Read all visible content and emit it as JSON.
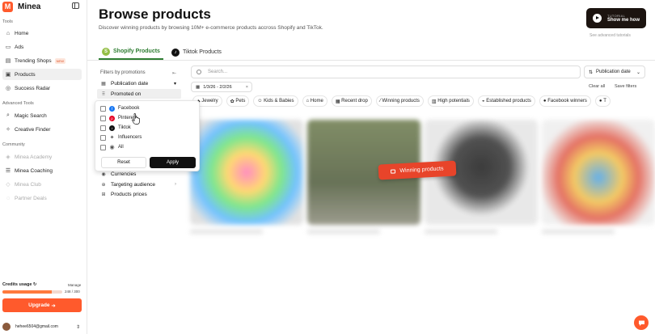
{
  "app": {
    "name": "Minea"
  },
  "sidebar": {
    "section_tools": "Tools",
    "tools": [
      {
        "label": "Home",
        "icon": "home-icon"
      },
      {
        "label": "Ads",
        "icon": "ads-icon"
      },
      {
        "label": "Trending Shops",
        "icon": "shop-icon",
        "badge": "NEW"
      },
      {
        "label": "Products",
        "icon": "products-icon",
        "active": true
      },
      {
        "label": "Success Radar",
        "icon": "radar-icon"
      }
    ],
    "section_advanced": "Advanced Tools",
    "advanced": [
      {
        "label": "Magic Search",
        "icon": "magic-search-icon"
      },
      {
        "label": "Creative Finder",
        "icon": "creative-icon"
      }
    ],
    "section_community": "Community",
    "community": [
      {
        "label": "Minea Academy",
        "icon": "academy-icon",
        "muted": true
      },
      {
        "label": "Minea Coaching",
        "icon": "coaching-icon",
        "muted": false
      },
      {
        "label": "Minea Club",
        "icon": "club-icon",
        "muted": true
      },
      {
        "label": "Partner Deals",
        "icon": "deals-icon",
        "muted": true
      }
    ],
    "credits": {
      "label": "Credits usage",
      "manage": "Manage",
      "count": "248 / 300",
      "fraction": 0.83
    },
    "upgrade_label": "Upgrade",
    "user_email": "hehee6504@gmail.com"
  },
  "header": {
    "title": "Browse products",
    "subtitle": "Discover winning products by browsing 10M+ e-commerce products accross Shopify and TikTok.",
    "tutorial_kicker": "TUTORIAL",
    "tutorial_label": "Show me how",
    "see_advanced": "See advanced tutorials"
  },
  "tabs": [
    {
      "label": "Shopify Products",
      "active": true
    },
    {
      "label": "Tiktok Products",
      "active": false
    }
  ],
  "search": {
    "placeholder": "Search..."
  },
  "sort": {
    "label": "Publication date"
  },
  "date_chip": "1/3/26 - 2/2/26",
  "actions": {
    "clear_all": "Clear all",
    "save_filters": "Save filters"
  },
  "categories": [
    "Jewelry",
    "Pets",
    "Kids & Babies",
    "Home",
    "Recent drop",
    "Winning products",
    "High potentials",
    "Established products",
    "Facebook winners",
    "T"
  ],
  "filters": {
    "title": "Filters by promotions",
    "rows": [
      {
        "label": "Publication date",
        "icon": "calendar-icon"
      },
      {
        "label": "Promoted on",
        "icon": "grid-icon"
      },
      {
        "label": "Currencies",
        "icon": "currency-icon"
      },
      {
        "label": "Targeting audience",
        "icon": "target-icon"
      },
      {
        "label": "Products prices",
        "icon": "tag-icon"
      }
    ],
    "dropdown": {
      "options": [
        {
          "label": "Facebook",
          "color": "#1877f2"
        },
        {
          "label": "Pinterest",
          "color": "#e60023"
        },
        {
          "label": "Tiktok",
          "color": "#111111"
        },
        {
          "label": "Influencers",
          "color": "#555555"
        },
        {
          "label": "All",
          "color": "#555555"
        }
      ],
      "reset": "Reset",
      "apply": "Apply"
    }
  },
  "winning_badge": "Winning products",
  "colors": {
    "accent": "#ff5a2c",
    "shopify_green": "#2e7d32",
    "badge_red": "#e8442a"
  }
}
